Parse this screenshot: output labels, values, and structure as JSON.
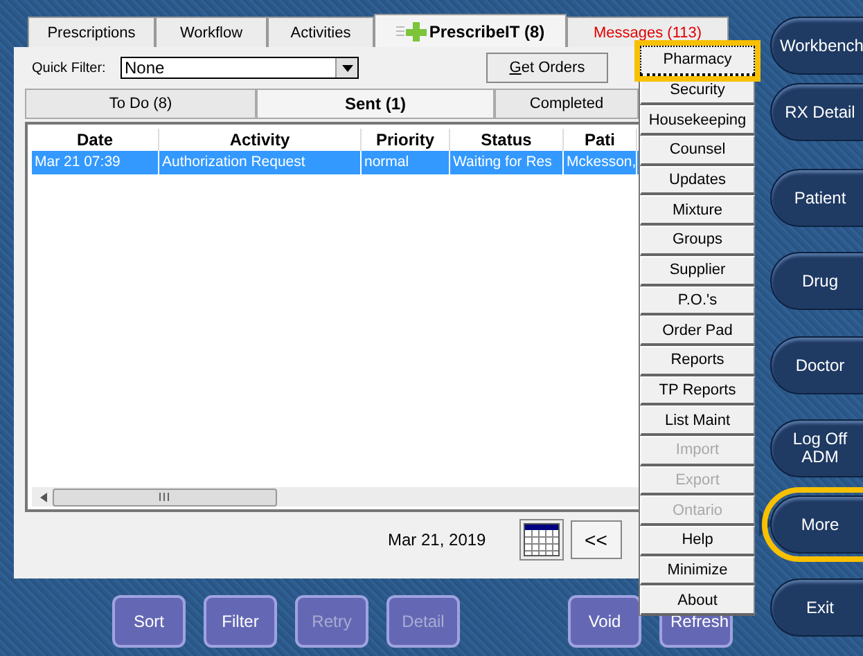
{
  "tabs": [
    {
      "label": "Prescriptions",
      "selected": false,
      "kind": "plain"
    },
    {
      "label": "Workflow",
      "selected": false,
      "kind": "plain"
    },
    {
      "label": "Activities",
      "selected": false,
      "kind": "plain"
    },
    {
      "label": "PrescribeIT (8)",
      "selected": true,
      "kind": "brand"
    },
    {
      "label": "Messages (113)",
      "selected": false,
      "kind": "alert"
    }
  ],
  "quick_filter": {
    "label": "Quick Filter:",
    "value": "None"
  },
  "get_orders_button": "Get Orders",
  "subtabs": [
    {
      "label": "To Do (8)",
      "selected": false
    },
    {
      "label": "Sent (1)",
      "selected": true
    },
    {
      "label": "Completed",
      "selected": false
    }
  ],
  "table": {
    "columns": [
      "Date",
      "Activity",
      "Priority",
      "Status",
      "Pati"
    ],
    "rows": [
      {
        "cells": [
          "Mar 21 07:39",
          "Authorization Request",
          "normal",
          "Waiting for Res",
          "Mckesson,"
        ],
        "selected": true
      }
    ]
  },
  "footer": {
    "date": "Mar 21, 2019",
    "prev_button": "<<"
  },
  "bottom_buttons": [
    {
      "label": "Sort",
      "disabled": false
    },
    {
      "label": "Filter",
      "disabled": false
    },
    {
      "label": "Retry",
      "disabled": true
    },
    {
      "label": "Detail",
      "disabled": true
    },
    {
      "label": "Void",
      "disabled": false
    },
    {
      "label": "Refresh",
      "disabled": false
    }
  ],
  "menu": [
    {
      "label": "Pharmacy",
      "disabled": false,
      "highlighted": true
    },
    {
      "label": "Security",
      "disabled": false,
      "highlighted": false
    },
    {
      "label": "Housekeeping",
      "disabled": false,
      "highlighted": false
    },
    {
      "label": "Counsel",
      "disabled": false,
      "highlighted": false
    },
    {
      "label": "Updates",
      "disabled": false,
      "highlighted": false
    },
    {
      "label": "Mixture",
      "disabled": false,
      "highlighted": false
    },
    {
      "label": "Groups",
      "disabled": false,
      "highlighted": false
    },
    {
      "label": "Supplier",
      "disabled": false,
      "highlighted": false
    },
    {
      "label": "P.O.'s",
      "disabled": false,
      "highlighted": false
    },
    {
      "label": "Order Pad",
      "disabled": false,
      "highlighted": false
    },
    {
      "label": "Reports",
      "disabled": false,
      "highlighted": false
    },
    {
      "label": "TP Reports",
      "disabled": false,
      "highlighted": false
    },
    {
      "label": "List Maint",
      "disabled": false,
      "highlighted": false
    },
    {
      "label": "Import",
      "disabled": true,
      "highlighted": false
    },
    {
      "label": "Export",
      "disabled": true,
      "highlighted": false
    },
    {
      "label": "Ontario",
      "disabled": true,
      "highlighted": false
    },
    {
      "label": "Help",
      "disabled": false,
      "highlighted": false
    },
    {
      "label": "Minimize",
      "disabled": false,
      "highlighted": false
    },
    {
      "label": "About",
      "disabled": false,
      "highlighted": false
    }
  ],
  "nav": [
    {
      "label": "Workbench",
      "highlighted": false
    },
    {
      "label": "RX Detail",
      "highlighted": false
    },
    {
      "label": "Patient",
      "highlighted": false
    },
    {
      "label": "Drug",
      "highlighted": false
    },
    {
      "label": "Doctor",
      "highlighted": false
    },
    {
      "label": "Log Off ADM",
      "highlighted": false
    },
    {
      "label": "More",
      "highlighted": true
    },
    {
      "label": "Exit",
      "highlighted": false
    }
  ]
}
